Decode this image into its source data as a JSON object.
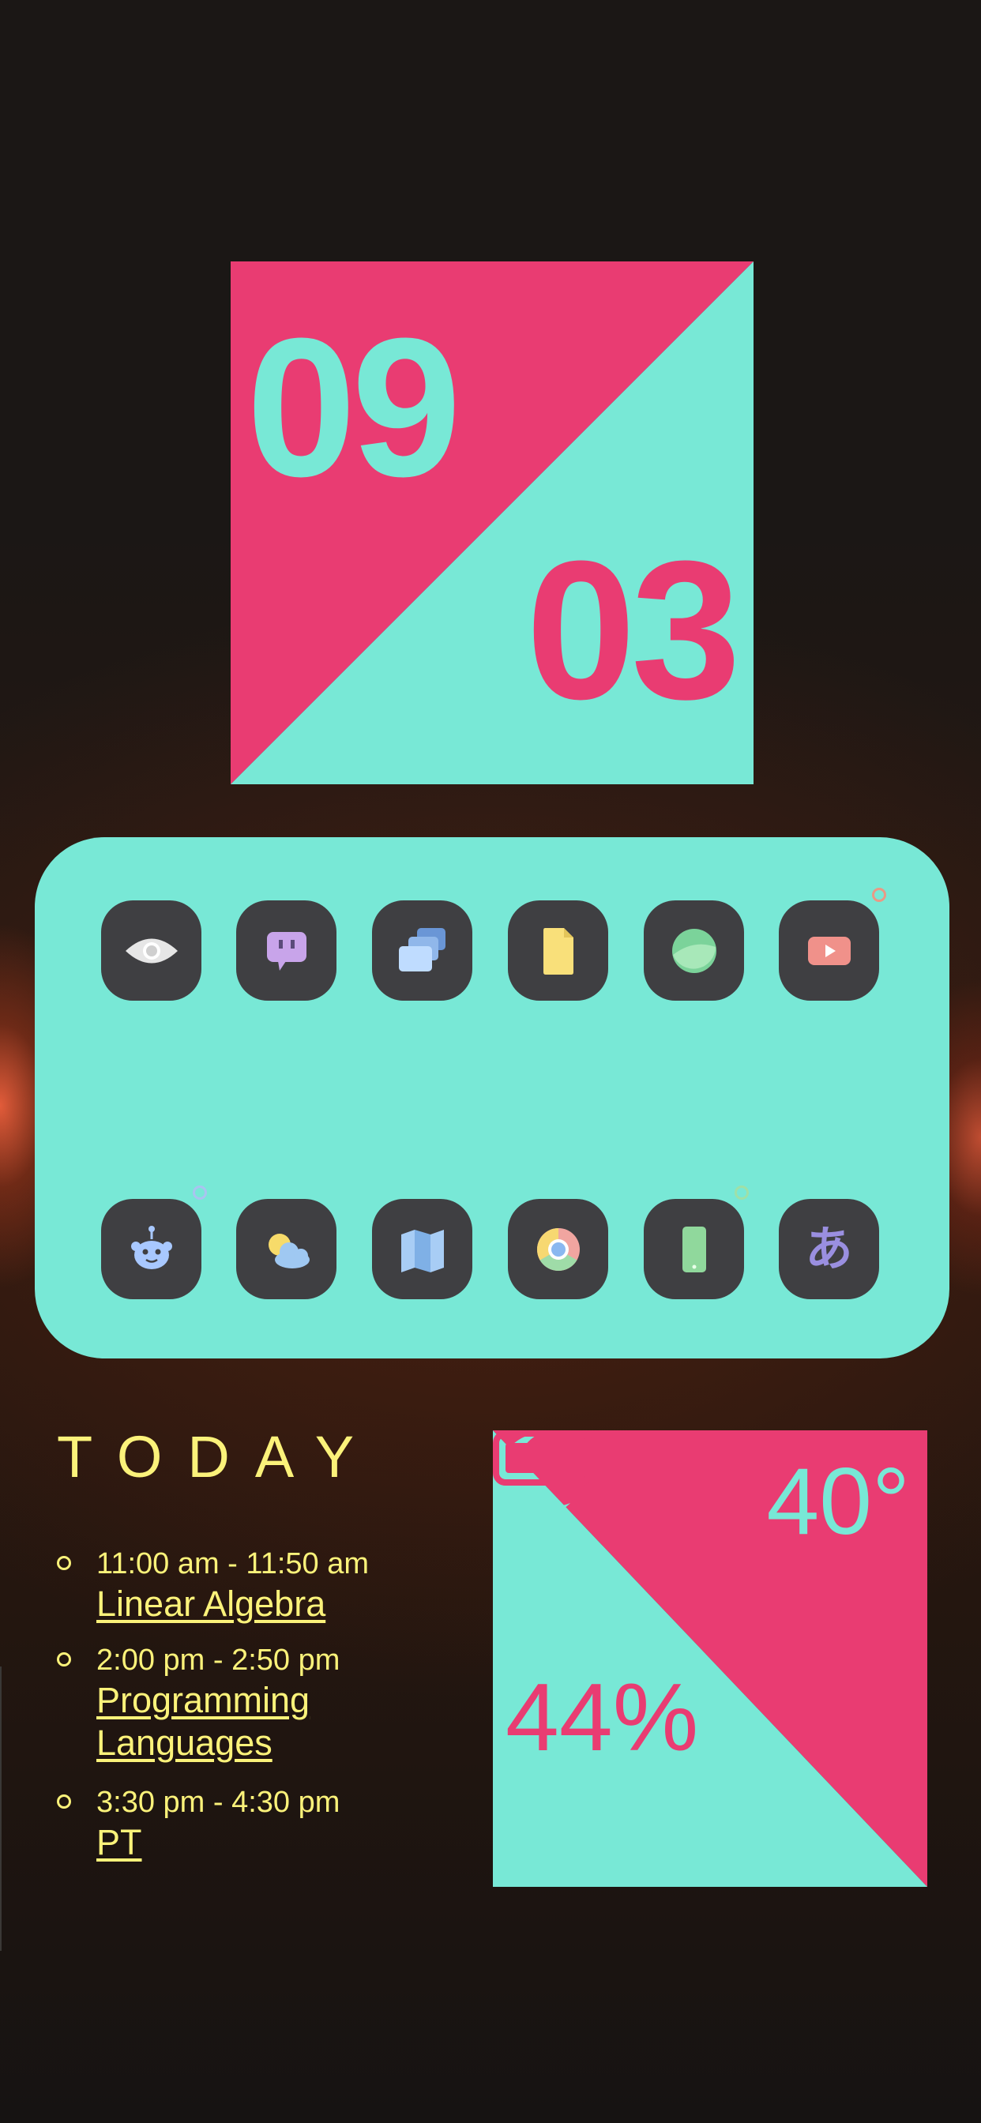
{
  "colors": {
    "pink": "#e93c72",
    "mint": "#78e8d6",
    "yellow": "#fbf27a",
    "tile": "#3f3f42"
  },
  "date_widget": {
    "day": "09",
    "month": "03"
  },
  "dock": {
    "apps": [
      {
        "icon": "eye-icon"
      },
      {
        "icon": "chat-icon"
      },
      {
        "icon": "cards-icon"
      },
      {
        "icon": "file-icon"
      },
      {
        "icon": "sphere-icon"
      },
      {
        "icon": "youtube-icon",
        "has_notification": true
      },
      {
        "icon": "reddit-icon",
        "has_notification": true
      },
      {
        "icon": "weather-icon"
      },
      {
        "icon": "map-icon"
      },
      {
        "icon": "chrome-icon"
      },
      {
        "icon": "phone-icon",
        "has_notification": true
      },
      {
        "icon": "japanese-icon",
        "glyph": "あ"
      }
    ]
  },
  "today": {
    "title": "TODAY",
    "events": [
      {
        "time": "11:00 am - 11:50 am",
        "title": "Linear Algebra"
      },
      {
        "time": "2:00 pm - 2:50 pm",
        "title": "Programming Languages"
      },
      {
        "time": "3:30 pm - 4:30 pm",
        "title": "PT"
      }
    ]
  },
  "weather": {
    "temperature": "40°",
    "condition_icon": "moon-icon",
    "battery_percent": "44%",
    "battery_level": 0.44
  }
}
